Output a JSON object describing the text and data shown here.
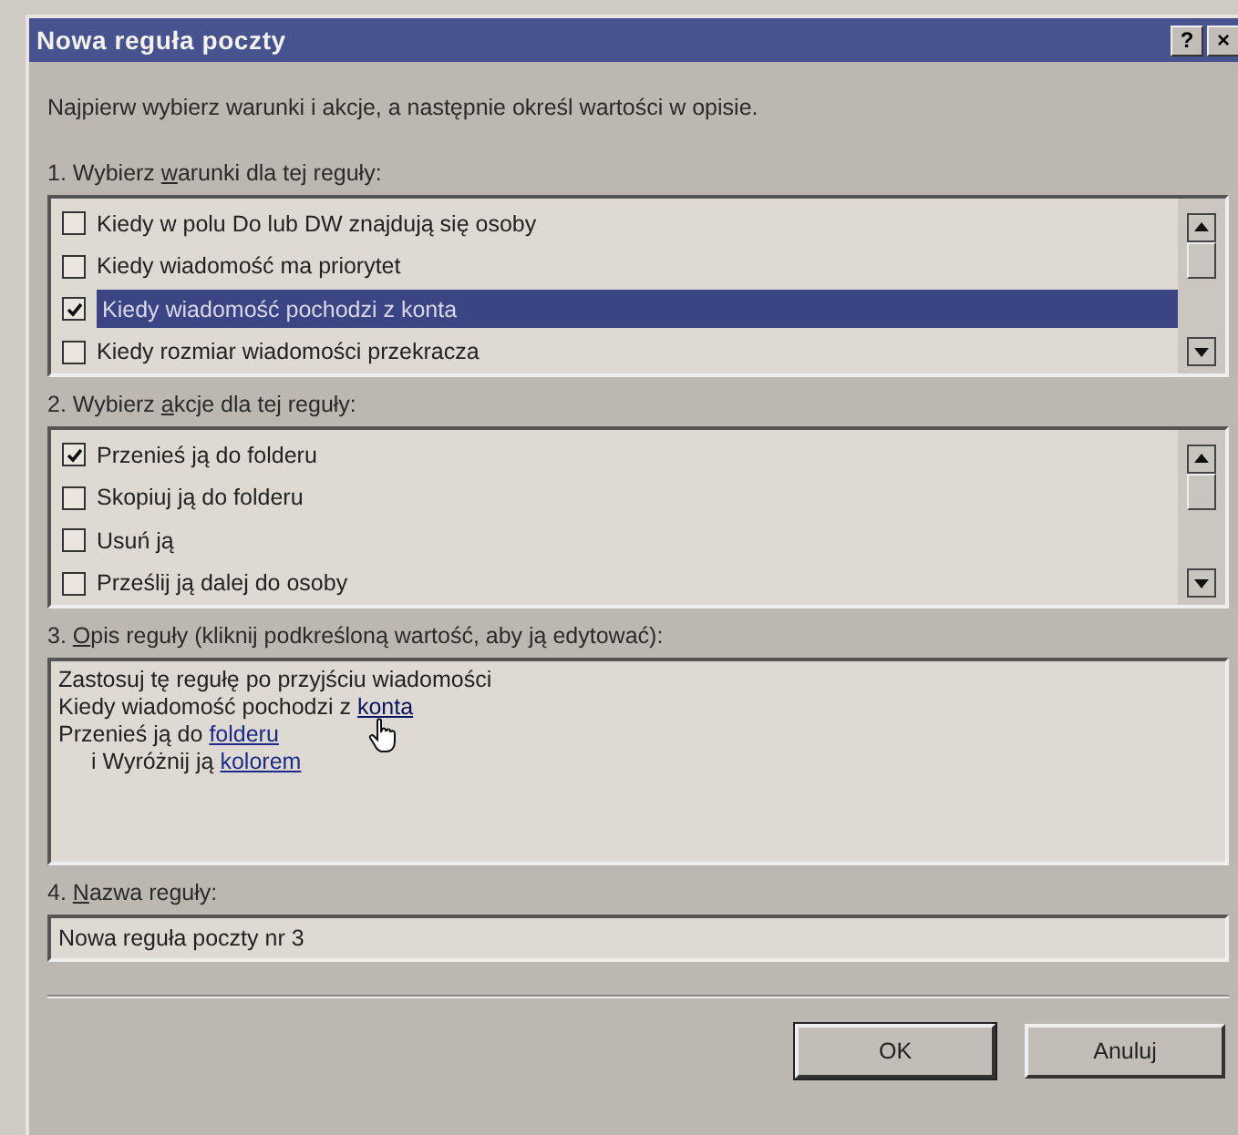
{
  "window": {
    "title": "Nowa reguła poczty",
    "buttons": [
      "?",
      "×"
    ]
  },
  "intro": "Najpierw wybierz warunki i akcje, a następnie określ wartości w opisie.",
  "conditions": {
    "label": {
      "before": "1. Wybierz ",
      "key": "w",
      "after": "arunki dla tej reguły:"
    },
    "items": [
      {
        "label": "Kiedy w polu Do lub DW znajdują się osoby",
        "checked": false,
        "selected": false
      },
      {
        "label": "Kiedy wiadomość ma priorytet",
        "checked": false,
        "selected": false
      },
      {
        "label": "Kiedy wiadomość pochodzi z konta",
        "checked": true,
        "selected": true
      },
      {
        "label": "Kiedy rozmiar wiadomości przekracza",
        "checked": false,
        "selected": false
      }
    ]
  },
  "actions": {
    "label": {
      "before": "2. Wybierz ",
      "key": "a",
      "after": "kcje dla tej reguły:"
    },
    "items": [
      {
        "label": "Przenieś ją do folderu",
        "checked": true,
        "selected": false
      },
      {
        "label": "Skopiuj ją do folderu",
        "checked": false,
        "selected": false
      },
      {
        "label": "Usuń ją",
        "checked": false,
        "selected": false
      },
      {
        "label": "Prześlij ją dalej do osoby",
        "checked": false,
        "selected": false
      }
    ]
  },
  "description": {
    "label": {
      "before": "3. ",
      "key": "O",
      "after": "pis reguły (kliknij podkreśloną wartość, aby ją edytować):"
    },
    "lines": [
      {
        "indented": false,
        "parts": [
          {
            "text": "Zastosuj tę regułę po przyjściu wiadomości",
            "link": false
          }
        ]
      },
      {
        "indented": false,
        "parts": [
          {
            "text": "Kiedy wiadomość pochodzi z ",
            "link": false
          },
          {
            "text": "konta",
            "link": true,
            "hovered": true
          }
        ]
      },
      {
        "indented": false,
        "parts": [
          {
            "text": "Przenieś ją do ",
            "link": false
          },
          {
            "text": "folderu",
            "link": true,
            "hovered": false
          }
        ]
      },
      {
        "indented": true,
        "parts": [
          {
            "text": "i Wyróżnij ją ",
            "link": false
          },
          {
            "text": "kolorem",
            "link": true,
            "hovered": false
          }
        ]
      }
    ]
  },
  "name": {
    "label": {
      "before": "4. ",
      "key": "N",
      "after": "azwa reguły:"
    },
    "value": "Nowa reguła poczty nr 3"
  },
  "buttons": [
    "OK",
    "Anuluj"
  ]
}
